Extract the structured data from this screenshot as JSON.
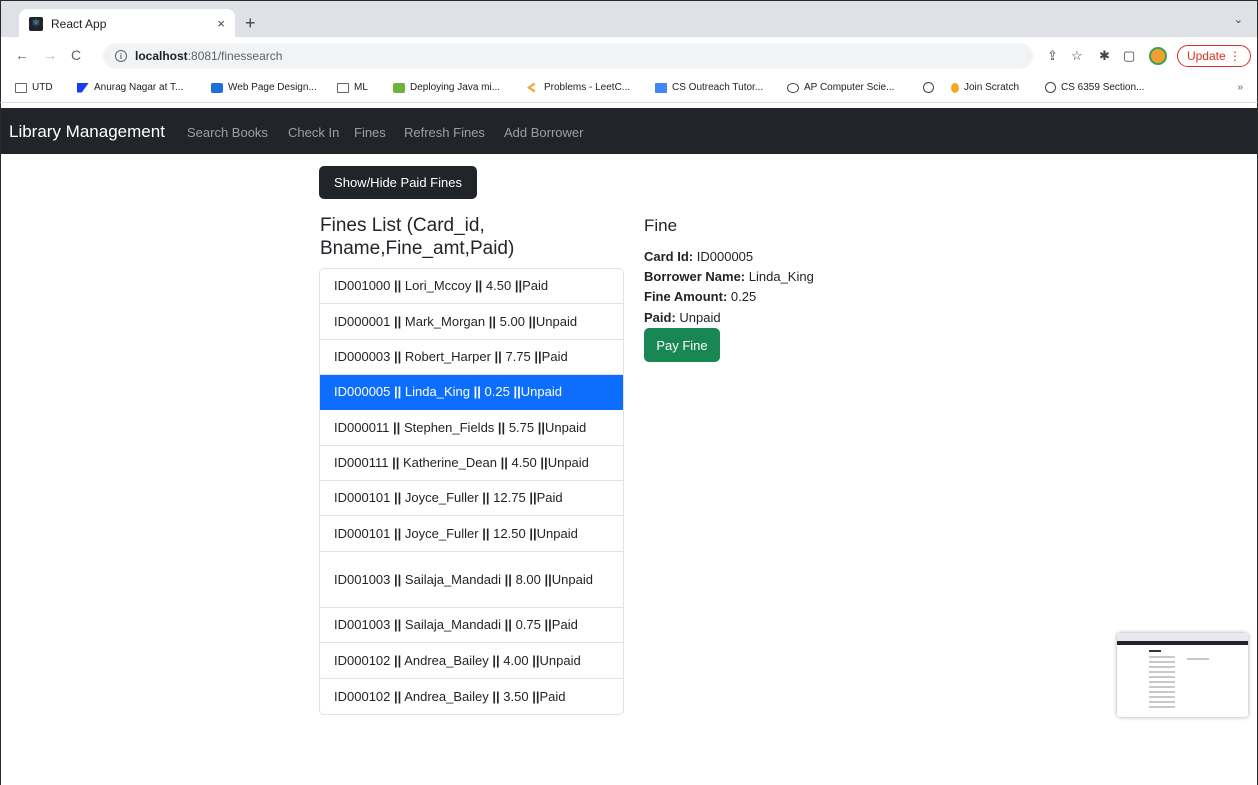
{
  "browser": {
    "tab_title": "React App",
    "tab_close": "×",
    "new_tab": "+",
    "tabbar_menu": "⌄",
    "url_host": "localhost",
    "url_path": ":8081/finessearch",
    "update_label": "Update",
    "bookmarks": [
      {
        "label": "UTD",
        "icon": "folder-icon"
      },
      {
        "label": "Anurag Nagar at T...",
        "icon": "flag-icon"
      },
      {
        "label": "Web Page Design...",
        "icon": "box-icon"
      },
      {
        "label": "ML",
        "icon": "folder-icon"
      },
      {
        "label": "Deploying Java mi...",
        "icon": "spring-icon"
      },
      {
        "label": "Problems - LeetC...",
        "icon": "leetcode-icon"
      },
      {
        "label": "CS Outreach Tutor...",
        "icon": "doc-icon"
      },
      {
        "label": "AP Computer Scie...",
        "icon": "cap-icon"
      },
      {
        "label": "",
        "icon": "globe-icon"
      },
      {
        "label": "Join Scratch",
        "icon": "scratch-icon"
      },
      {
        "label": "CS 6359 Section...",
        "icon": "globe-icon"
      }
    ],
    "bookmarks_more": "»"
  },
  "navbar": {
    "brand": "Library Management",
    "links": [
      "Search Books",
      "Check In",
      "Fines",
      "Refresh Fines",
      "Add Borrower"
    ]
  },
  "main": {
    "toggle_label": "Show/Hide Paid Fines",
    "list_title": "Fines List (Card_id, Bname,Fine_amt,Paid)",
    "fines": [
      {
        "card_id": "ID001000",
        "bname": "Lori_Mccoy",
        "amt": "4.50",
        "paid": "Paid"
      },
      {
        "card_id": "ID000001",
        "bname": "Mark_Morgan",
        "amt": "5.00",
        "paid": "Unpaid"
      },
      {
        "card_id": "ID000003",
        "bname": "Robert_Harper",
        "amt": "7.75",
        "paid": "Paid"
      },
      {
        "card_id": "ID000005",
        "bname": "Linda_King",
        "amt": "0.25",
        "paid": "Unpaid"
      },
      {
        "card_id": "ID000011",
        "bname": "Stephen_Fields",
        "amt": "5.75",
        "paid": "Unpaid"
      },
      {
        "card_id": "ID000111",
        "bname": "Katherine_Dean",
        "amt": "4.50",
        "paid": "Unpaid"
      },
      {
        "card_id": "ID000101",
        "bname": "Joyce_Fuller",
        "amt": "12.75",
        "paid": "Paid"
      },
      {
        "card_id": "ID000101",
        "bname": "Joyce_Fuller",
        "amt": "12.50",
        "paid": "Unpaid"
      },
      {
        "card_id": "ID001003",
        "bname": "Sailaja_Mandadi",
        "amt": "8.00",
        "paid": "Unpaid"
      },
      {
        "card_id": "ID001003",
        "bname": "Sailaja_Mandadi",
        "amt": "0.75",
        "paid": "Paid"
      },
      {
        "card_id": "ID000102",
        "bname": "Andrea_Bailey",
        "amt": "4.00",
        "paid": "Unpaid"
      },
      {
        "card_id": "ID000102",
        "bname": "Andrea_Bailey",
        "amt": "3.50",
        "paid": "Paid"
      }
    ],
    "separator": "||",
    "selected_index": 3
  },
  "detail": {
    "title": "Fine",
    "card_id_label": "Card Id:",
    "card_id": "ID000005",
    "borrower_label": "Borrower Name:",
    "borrower": "Linda_King",
    "amount_label": "Fine Amount:",
    "amount": "0.25",
    "paid_label": "Paid:",
    "paid": "Unpaid",
    "pay_label": "Pay Fine"
  },
  "colors": {
    "navbar_bg": "#212529",
    "active_item": "#0d6efd",
    "pay_button": "#198754",
    "update_red": "#d93025"
  }
}
